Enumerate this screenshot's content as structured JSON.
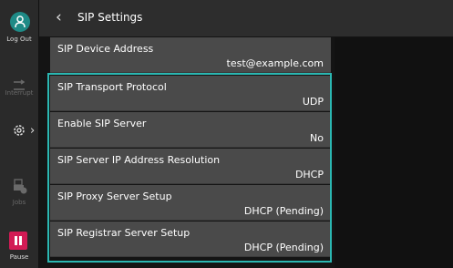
{
  "rail": {
    "logout_label": "Log Out",
    "interrupt_label": "Interrupt",
    "jobs_label": "Jobs",
    "pause_label": "Pause"
  },
  "header": {
    "title": "SIP Settings"
  },
  "rows": [
    {
      "label": "SIP Device Address",
      "value": "test@example.com"
    },
    {
      "label": "SIP Transport Protocol",
      "value": "UDP"
    },
    {
      "label": "Enable SIP Server",
      "value": "No"
    },
    {
      "label": "SIP Server IP Address Resolution",
      "value": "DHCP"
    },
    {
      "label": "SIP Proxy Server Setup",
      "value": "DHCP (Pending)"
    },
    {
      "label": "SIP Registrar Server Setup",
      "value": "DHCP (Pending)"
    }
  ],
  "colors": {
    "accent": "#2bb7b2",
    "pause": "#d21b55"
  }
}
